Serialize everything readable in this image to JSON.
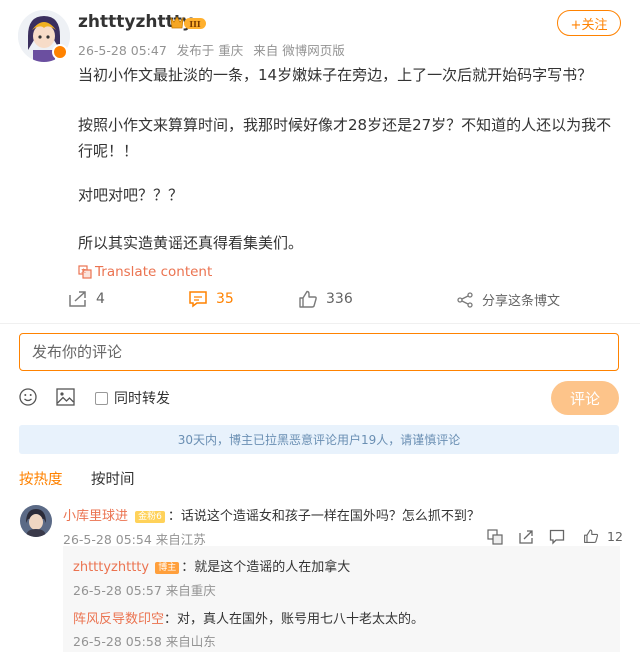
{
  "post": {
    "username": "zhtttyzhttty",
    "vip_level": "III",
    "time": "26-5-28 05:47",
    "location": "发布于 重庆",
    "source": "来自 微博网页版",
    "follow_label": "+关注",
    "paragraphs": [
      "当初小作文最扯淡的一条，14岁嫩妹子在旁边，上了一次后就开始码字写书？",
      "按照小作文来算算时间，我那时候好像才28岁还是27岁？不知道的人还以为我不行呢！！",
      "对吧对吧？？？",
      "所以其实造黄谣还真得看集美们。"
    ],
    "translate_label": "Translate content"
  },
  "actions": {
    "repost_count": "4",
    "comment_count": "35",
    "like_count": "336",
    "share_label": "分享这条博文"
  },
  "composer": {
    "placeholder": "发布你的评论",
    "also_repost_label": "同时转发",
    "submit_label": "评论"
  },
  "notice": "30天内，博主已拉黑恶意评论用户19人，请谨慎评论",
  "sort_tabs": {
    "hot": "按热度",
    "time": "按时间"
  },
  "comments": [
    {
      "name": "小库里球进",
      "badge": "金粉6",
      "text": "：话说这个造谣女和孩子一样在国外吗？怎么抓不到？",
      "meta": "26-5-28 05:54 来自江苏",
      "like_count": "12",
      "replies": [
        {
          "name": "zhtttyzhttty",
          "badge": "博主",
          "text": "：就是这个造谣的人在加拿大",
          "meta": "26-5-28 05:57 来自重庆"
        },
        {
          "name": "阵风反导数印空",
          "badge": "",
          "text": "：对，真人在国外，账号用七八十老太太的。",
          "meta": "26-5-28 05:58 来自山东"
        }
      ]
    }
  ],
  "colors": {
    "accent": "#ff8200",
    "name_link": "#eb7350",
    "notice_bg": "#e8f2fc",
    "submit_disabled": "#fdc48a"
  }
}
